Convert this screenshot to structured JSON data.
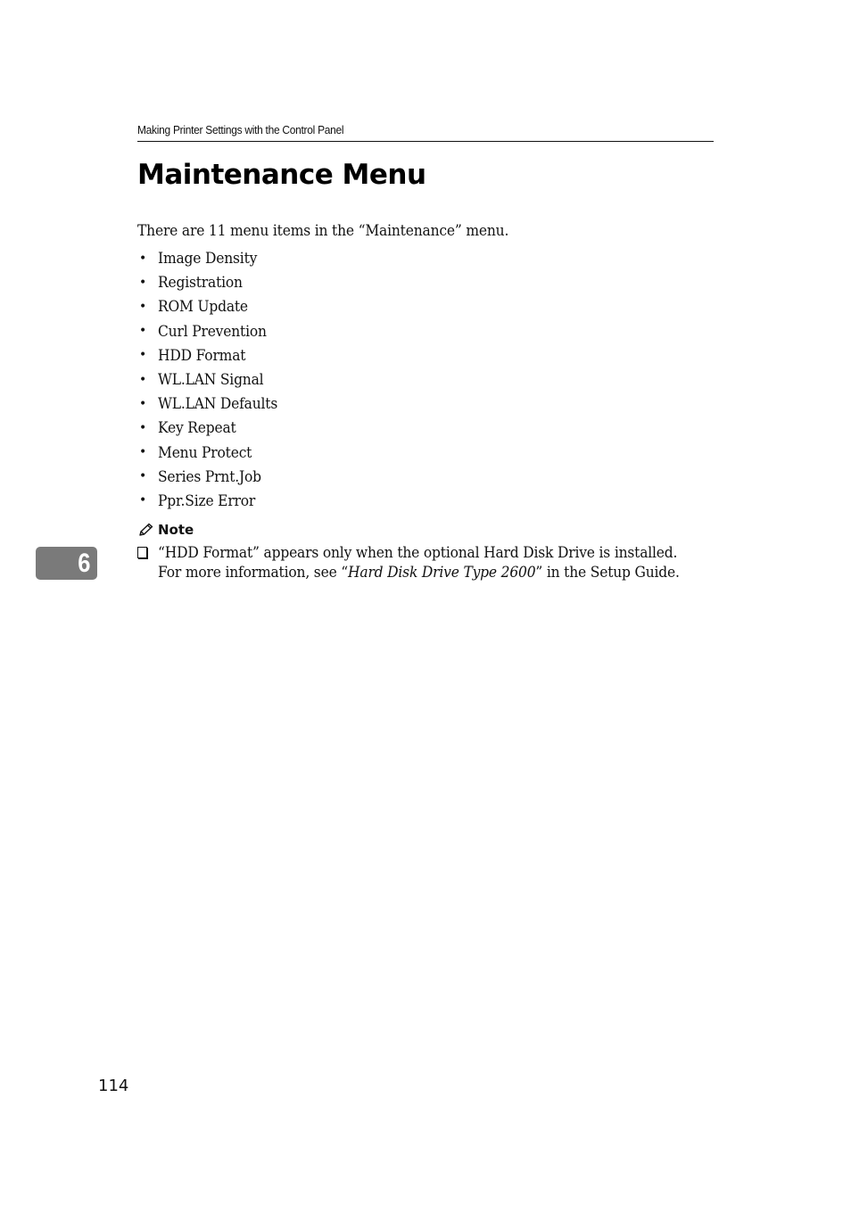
{
  "running_header": "Making Printer Settings with the Control Panel",
  "title": "Maintenance Menu",
  "intro": "There are 11 menu items in the “Maintenance” menu.",
  "menu_items": [
    {
      "label": "Image Density"
    },
    {
      "label": "Registration"
    },
    {
      "label": "ROM Update"
    },
    {
      "label": "Curl Prevention"
    },
    {
      "label": "HDD Format"
    },
    {
      "label": "WL.LAN Signal"
    },
    {
      "label": "WL.LAN Defaults"
    },
    {
      "label": "Key Repeat"
    },
    {
      "label": "Menu Protect"
    },
    {
      "label": "Series Prnt.Job"
    },
    {
      "label": "Ppr.Size Error"
    }
  ],
  "bullet_glyph": "•",
  "note": {
    "icon": "pencil-icon",
    "heading": "Note",
    "line1": "“HDD Format” appears only when the optional Hard Disk Drive is installed.",
    "line2_prefix": "For more information, see “",
    "line2_italic": "Hard Disk Drive Type 2600",
    "line2_suffix": "” in the Setup Guide."
  },
  "chapter_tab": {
    "number": "6",
    "color": "#7a7a7a"
  },
  "page_number": "114"
}
